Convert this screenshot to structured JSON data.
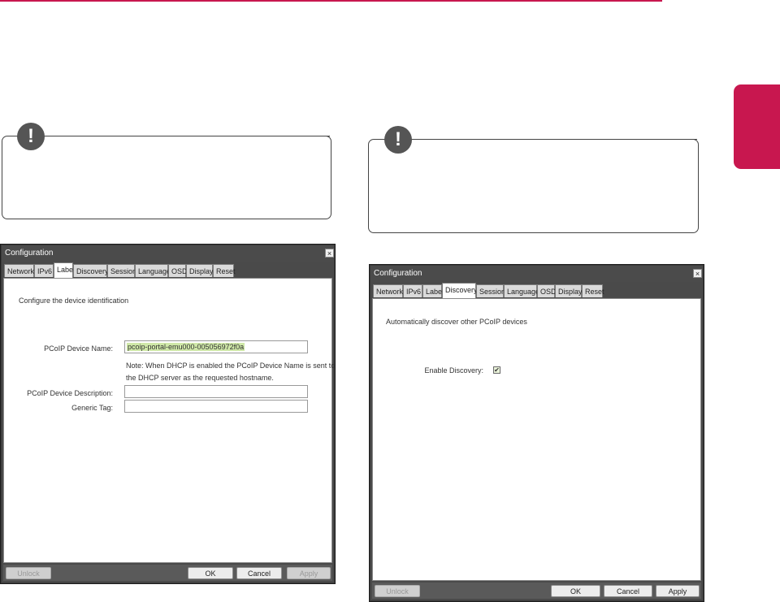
{
  "colors": {
    "accent": "#c8174f",
    "dialog_frame": "#4a4a4a",
    "highlight": "#cfe8a8"
  },
  "notes": [
    {
      "icon": "exclamation-icon",
      "symbol": "!"
    },
    {
      "icon": "exclamation-icon",
      "symbol": "!"
    }
  ],
  "dialog_label": {
    "title": "Configuration",
    "close": "×",
    "tabs": [
      "Network",
      "IPv6",
      "Label",
      "Discovery",
      "Session",
      "Language",
      "OSD",
      "Display",
      "Reset"
    ],
    "active_tab": "Label",
    "description": "Configure the device identification",
    "fields": {
      "device_name_label": "PCoIP Device Name:",
      "device_name_value": "pcoip-portal-emu000-005056972f0a",
      "note_line1": "Note: When DHCP is enabled the PCoIP Device Name is sent to",
      "note_line2": "the DHCP server as the requested hostname.",
      "device_description_label": "PCoIP Device Description:",
      "device_description_value": "",
      "generic_tag_label": "Generic Tag:",
      "generic_tag_value": ""
    },
    "buttons": {
      "unlock": "Unlock",
      "ok": "OK",
      "cancel": "Cancel",
      "apply": "Apply"
    }
  },
  "dialog_discovery": {
    "title": "Configuration",
    "close": "×",
    "tabs": [
      "Network",
      "IPv6",
      "Label",
      "Discovery",
      "Session",
      "Language",
      "OSD",
      "Display",
      "Reset"
    ],
    "active_tab": "Discovery",
    "description": "Automatically discover other PCoIP devices",
    "enable_discovery_label": "Enable Discovery:",
    "enable_discovery_checked": true,
    "check_mark": "✔",
    "buttons": {
      "unlock": "Unlock",
      "ok": "OK",
      "cancel": "Cancel",
      "apply": "Apply"
    }
  }
}
